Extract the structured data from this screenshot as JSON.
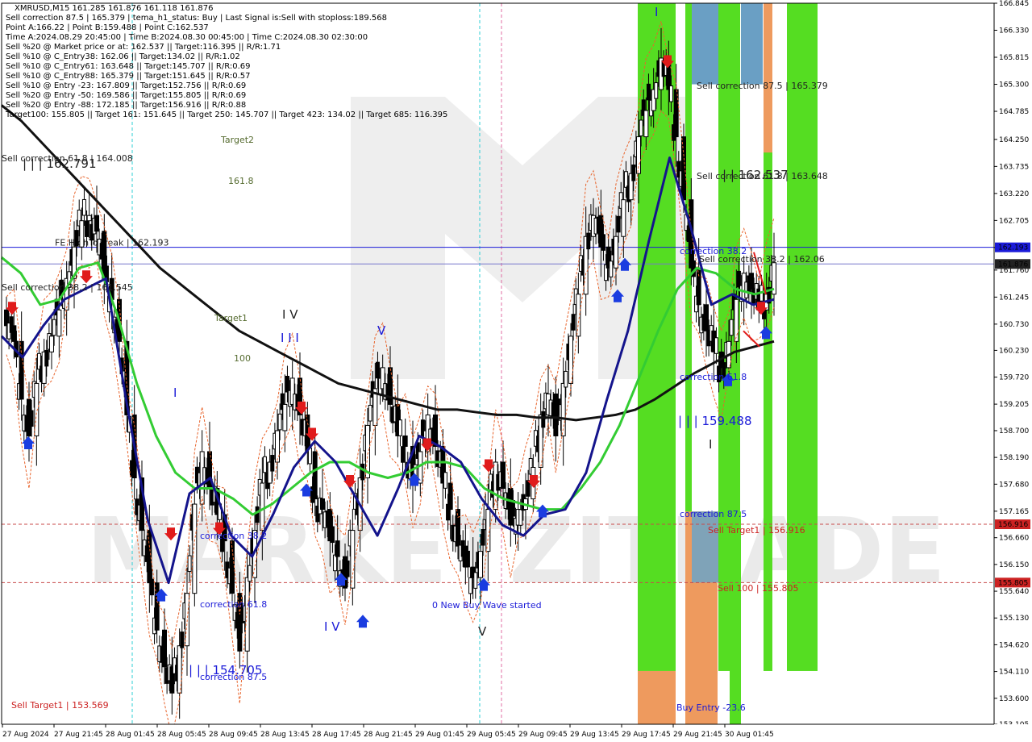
{
  "header": {
    "lines": [
      "XMRUSD,M15  161.285 161.876 161.118 161.876",
      "Sell correction 87.5 | 165.379 | tema_h1_status: Buy | Last Signal is:Sell with stoploss:189.568",
      "Point A:166.22 | Point B:159.488 | Point C:162.537",
      "Time A:2024.08.29 20:45:00 | Time B:2024.08.30 00:45:00 | Time C:2024.08.30 02:30:00",
      "Sell %20 @ Market price or at: 162.537 || Target:116.395 || R/R:1.71",
      "Sell %10 @ C_Entry38: 162.06 || Target:134.02 || R/R:1.02",
      "Sell %10 @ C_Entry61: 163.648 || Target:145.707 || R/R:0.69",
      "Sell %10 @ C_Entry88: 165.379 || Target:151.645 || R/R:0.57",
      "Sell %10 @ Entry -23: 167.809 || Target:152.756 || R/R:0.69",
      "Sell %20 @ Entry -50: 169.586 || Target:155.805 || R/R:0.69",
      "Sell %20 @ Entry -88: 172.185 || Target:156.916 || R/R:0.88",
      "Target100: 155.805 || Target 161: 151.645 || Target 250: 145.707 || Target 423: 134.02 || Target 685: 116.395"
    ]
  },
  "chart_data": {
    "type": "candlestick",
    "symbol": "XMRUSD",
    "timeframe": "M15",
    "ohlc": {
      "open": 161.285,
      "high": 161.876,
      "low": 161.118,
      "close": 161.876
    },
    "ylim": [
      153.105,
      166.845
    ],
    "y_ticks": [
      "166.845",
      "166.330",
      "165.815",
      "165.300",
      "164.785",
      "164.250",
      "163.735",
      "163.220",
      "162.705",
      "162.190",
      "161.760",
      "161.245",
      "160.730",
      "160.230",
      "159.720",
      "159.205",
      "158.700",
      "158.190",
      "157.680",
      "157.165",
      "156.660",
      "156.150",
      "155.640",
      "155.130",
      "154.620",
      "154.110",
      "153.600",
      "153.105"
    ],
    "x_labels": [
      "27 Aug 2024",
      "27 Aug 21:45",
      "28 Aug 01:45",
      "28 Aug 05:45",
      "28 Aug 09:45",
      "28 Aug 13:45",
      "28 Aug 17:45",
      "28 Aug 21:45",
      "29 Aug 01:45",
      "29 Aug 05:45",
      "29 Aug 09:45",
      "29 Aug 13:45",
      "29 Aug 17:45",
      "29 Aug 21:45",
      "30 Aug 01:45"
    ],
    "price_tags": [
      {
        "value": 162.193,
        "text": "162.193",
        "color": "#1a1ad8"
      },
      {
        "value": 161.876,
        "text": "161.876",
        "color": "#222222"
      },
      {
        "value": 156.916,
        "text": "156.916",
        "color": "#cc2222"
      },
      {
        "value": 155.805,
        "text": "155.805",
        "color": "#cc2222"
      }
    ],
    "levels": [
      {
        "value": 162.193,
        "color": "#1a1ad8",
        "dash": "none",
        "label": "FE HighToBreak | 162.193"
      },
      {
        "value": 161.876,
        "color": "#7777cc",
        "dash": "none",
        "label": ""
      },
      {
        "value": 156.916,
        "color": "#c84a4a",
        "dash": "4,3",
        "label": ""
      },
      {
        "value": 155.805,
        "color": "#c84a4a",
        "dash": "4,3",
        "label": ""
      }
    ],
    "close": [
      160.7,
      160.4,
      159.3,
      158.6,
      159.6,
      160.2,
      160.5,
      161.0,
      161.6,
      162.2,
      162.7,
      162.8,
      162.5,
      161.6,
      161.2,
      160.4,
      159.0,
      157.8,
      156.8,
      155.8,
      154.9,
      154.2,
      153.7,
      154.6,
      155.6,
      157.3,
      158.3,
      157.6,
      157.1,
      156.6,
      155.6,
      154.5,
      155.9,
      156.8,
      157.7,
      158.1,
      158.7,
      159.2,
      159.7,
      159.0,
      158.3,
      157.4,
      157.2,
      156.6,
      156.3,
      155.7,
      156.8,
      157.8,
      158.8,
      159.5,
      159.9,
      159.2,
      158.6,
      158.4,
      157.7,
      158.3,
      159.0,
      158.4,
      157.7,
      157.2,
      156.5,
      156.1,
      155.9,
      156.4,
      157.2,
      158.1,
      157.6,
      156.9,
      157.2,
      157.4,
      158.0,
      159.0,
      159.4,
      158.6,
      159.6,
      160.5,
      161.3,
      162.4,
      162.8,
      162.2,
      161.8,
      162.4,
      163.1,
      163.6,
      164.3,
      164.8,
      165.2,
      165.8,
      165.2,
      164.3,
      163.1,
      161.8,
      161.1,
      160.6,
      160.2,
      159.9,
      160.4,
      161.2,
      161.7,
      161.4,
      161.0,
      161.3,
      161.9
    ],
    "series": [
      {
        "name": "",
        "color": "#111111",
        "width": 3,
        "values": [
          164.9,
          164.6,
          164.2,
          163.8,
          163.4,
          163.0,
          162.6,
          162.2,
          161.8,
          161.5,
          161.2,
          160.9,
          160.6,
          160.4,
          160.2,
          160.0,
          159.8,
          159.6,
          159.5,
          159.4,
          159.3,
          159.2,
          159.1,
          159.1,
          159.05,
          159.0,
          159.0,
          158.95,
          158.95,
          158.9,
          158.95,
          159.0,
          159.1,
          159.3,
          159.55,
          159.8,
          160.0,
          160.2,
          160.3,
          160.4
        ]
      },
      {
        "name": "",
        "color": "#33cc33",
        "width": 3,
        "values": [
          162.0,
          161.7,
          161.1,
          161.2,
          161.8,
          161.9,
          160.9,
          159.6,
          158.6,
          157.9,
          157.6,
          157.6,
          157.4,
          157.1,
          157.3,
          157.6,
          157.9,
          158.1,
          158.1,
          157.9,
          157.8,
          157.9,
          158.1,
          158.1,
          158.0,
          157.6,
          157.4,
          157.3,
          157.2,
          157.2,
          157.6,
          158.1,
          158.8,
          159.7,
          160.6,
          161.4,
          161.8,
          161.7,
          161.4,
          161.3,
          161.4
        ]
      },
      {
        "name": "",
        "color": "#14148c",
        "width": 3,
        "values": [
          160.5,
          160.1,
          160.7,
          161.2,
          161.4,
          161.6,
          159.2,
          157.0,
          155.8,
          157.5,
          157.8,
          156.7,
          156.3,
          157.1,
          158.0,
          158.5,
          158.1,
          157.4,
          156.7,
          157.6,
          158.6,
          158.4,
          158.1,
          157.4,
          156.9,
          156.7,
          157.1,
          157.2,
          157.9,
          159.3,
          160.6,
          162.3,
          163.9,
          162.6,
          161.1,
          161.3,
          161.1,
          161.2
        ]
      }
    ],
    "zones": [
      {
        "color": "#55dd22",
        "value_top": 166.845,
        "value_bottom": 154.12
      },
      {
        "color": "#ee9a5e",
        "value_top": 154.12,
        "value_bottom": 153.105
      },
      {
        "color": "#6a9fc4",
        "value_top": 166.845,
        "value_bottom": 165.3
      },
      {
        "color": "#ee9a5e",
        "value_top": 157.16,
        "value_bottom": 153.105
      },
      {
        "color": "#7fa3b8",
        "value_top": 157.16,
        "value_bottom": 155.805
      }
    ],
    "annotations": [
      {
        "text": "Target2",
        "color": "#556b2f",
        "size": "ann"
      },
      {
        "text": "161.8",
        "color": "#556b2f",
        "size": "ann"
      },
      {
        "text": "Target1",
        "color": "#556b2f",
        "size": "ann"
      },
      {
        "text": "100",
        "color": "#556b2f",
        "size": "ann"
      },
      {
        "text": "Sell correction 61.8 | 164.008",
        "color": "#222222",
        "size": "ann"
      },
      {
        "text": "| | | 162.791",
        "color": "#222222",
        "size": "ann-big"
      },
      {
        "text": "Sell correction 38.2 | 161.545",
        "color": "#222222",
        "size": "ann"
      },
      {
        "text": "Sell correction 87.5 | 165.379",
        "color": "#222222",
        "size": "ann"
      },
      {
        "text": "Sell correction 61.8 | 163.648",
        "color": "#222222",
        "size": "ann"
      },
      {
        "text": "| | 162.537",
        "color": "#222222",
        "size": "ann-big"
      },
      {
        "text": "correction 38.2",
        "color": "#1a1ad8",
        "size": "ann"
      },
      {
        "text": "Sell correction 38.2 | 162.06",
        "color": "#222222",
        "size": "ann"
      },
      {
        "text": "I V",
        "color": "#222222",
        "size": "ann-big"
      },
      {
        "text": "I I I",
        "color": "#1a1ad8",
        "size": "ann-big"
      },
      {
        "text": "V",
        "color": "#1a1ad8",
        "size": "ann-big"
      },
      {
        "text": "I",
        "color": "#1a1ad8",
        "size": "ann-big"
      },
      {
        "text": "correction 38.2",
        "color": "#1a1ad8",
        "size": "ann"
      },
      {
        "text": "correction 61.8",
        "color": "#1a1ad8",
        "size": "ann"
      },
      {
        "text": "correction 87.5",
        "color": "#1a1ad8",
        "size": "ann"
      },
      {
        "text": "| | | 154.705",
        "color": "#1a1ad8",
        "size": "ann-big"
      },
      {
        "text": "I V",
        "color": "#1a1ad8",
        "size": "ann-big"
      },
      {
        "text": "0 New Buy Wave started",
        "color": "#1a1ad8",
        "size": "ann"
      },
      {
        "text": "V",
        "color": "#222222",
        "size": "ann-big"
      },
      {
        "text": "I",
        "color": "#1a1ad8",
        "size": "ann-big"
      },
      {
        "text": "correction 61.8",
        "color": "#1a1ad8",
        "size": "ann"
      },
      {
        "text": "| | | 159.488",
        "color": "#1a1ad8",
        "size": "ann-big"
      },
      {
        "text": "I",
        "color": "#222222",
        "size": "ann-big"
      },
      {
        "text": "correction 87.5",
        "color": "#1a1ad8",
        "size": "ann"
      },
      {
        "text": "Sell Target1 | 156.916",
        "color": "#cc2222",
        "size": "ann"
      },
      {
        "text": "Sell 100 | 155.805",
        "color": "#cc2222",
        "size": "ann"
      },
      {
        "text": "Sell Target1 | 153.569",
        "color": "#cc2222",
        "size": "ann"
      },
      {
        "text": "Buy Entry -23.6",
        "color": "#1a1ad8",
        "size": "ann"
      }
    ],
    "signals": [
      {
        "type": "sell",
        "value": 161.0
      },
      {
        "type": "buy",
        "value": 158.5
      },
      {
        "type": "sell",
        "value": 161.6
      },
      {
        "type": "sell",
        "value": 156.7
      },
      {
        "type": "buy",
        "value": 155.6
      },
      {
        "type": "sell",
        "value": 156.8
      },
      {
        "type": "sell",
        "value": 159.1
      },
      {
        "type": "sell",
        "value": 158.6
      },
      {
        "type": "buy",
        "value": 157.6
      },
      {
        "type": "sell",
        "value": 157.7
      },
      {
        "type": "buy",
        "value": 155.9
      },
      {
        "type": "buy",
        "value": 155.1
      },
      {
        "type": "buy",
        "value": 157.8
      },
      {
        "type": "sell",
        "value": 158.4
      },
      {
        "type": "buy",
        "value": 155.8
      },
      {
        "type": "sell",
        "value": 158.0
      },
      {
        "type": "sell",
        "value": 157.7
      },
      {
        "type": "buy",
        "value": 157.2
      },
      {
        "type": "sell",
        "value": 165.7
      },
      {
        "type": "buy",
        "value": 161.9
      },
      {
        "type": "buy",
        "value": 161.3
      },
      {
        "type": "buy",
        "value": 159.7
      },
      {
        "type": "buy",
        "value": 160.6
      },
      {
        "type": "sell",
        "value": 161.0
      }
    ],
    "watermark": "MARKETZITRADE"
  }
}
